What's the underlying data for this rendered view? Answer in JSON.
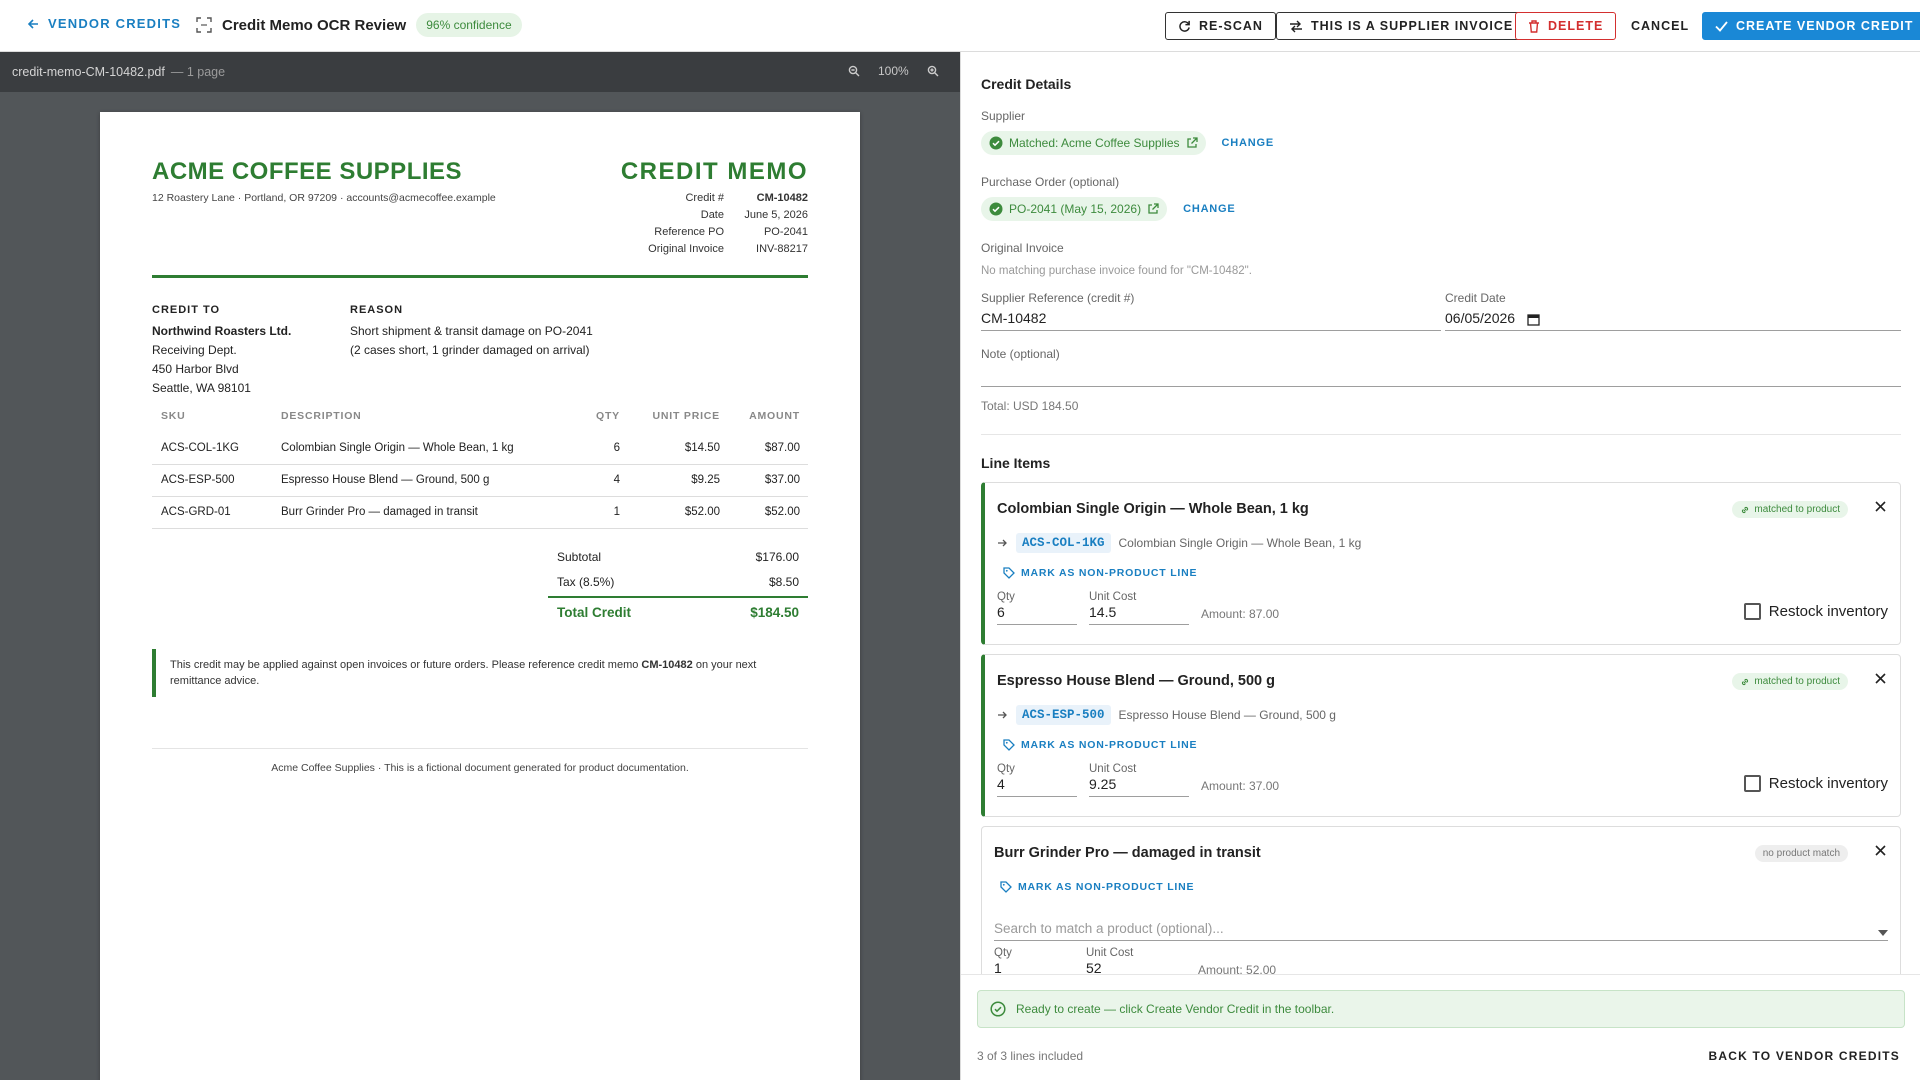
{
  "topbar": {
    "back_label": "VENDOR CREDITS",
    "title": "Credit Memo OCR Review",
    "confidence": "96% confidence",
    "rescan_label": "RE-SCAN",
    "supplier_invoice_label": "THIS IS A SUPPLIER INVOICE",
    "delete_label": "DELETE",
    "cancel_label": "CANCEL",
    "create_label": "CREATE VENDOR CREDIT"
  },
  "viewer": {
    "filename": "credit-memo-CM-10482.pdf",
    "pages": "— 1 page",
    "zoom": "100%"
  },
  "document": {
    "company": "ACME COFFEE SUPPLIES",
    "address": "12 Roastery Lane · Portland, OR 97209 · accounts@acmecoffee.example",
    "doc_title": "CREDIT MEMO",
    "meta": [
      {
        "k": "Credit #",
        "v": "CM-10482"
      },
      {
        "k": "Date",
        "v": "June 5, 2026"
      },
      {
        "k": "Reference PO",
        "v": "PO-2041"
      },
      {
        "k": "Original Invoice",
        "v": "INV-88217"
      }
    ],
    "credit_to_head": "CREDIT TO",
    "credit_to": [
      "Northwind Roasters Ltd.",
      "Receiving Dept.",
      "450 Harbor Blvd",
      "Seattle, WA 98101"
    ],
    "reason_head": "REASON",
    "reason": [
      "Short shipment & transit damage on PO-2041",
      "(2 cases short, 1 grinder damaged on arrival)"
    ],
    "table_headers": [
      "SKU",
      "DESCRIPTION",
      "QTY",
      "UNIT PRICE",
      "AMOUNT"
    ],
    "rows": [
      [
        "ACS-COL-1KG",
        "Colombian Single Origin — Whole Bean, 1 kg",
        "6",
        "$14.50",
        "$87.00"
      ],
      [
        "ACS-ESP-500",
        "Espresso House Blend — Ground, 500 g",
        "4",
        "$9.25",
        "$37.00"
      ],
      [
        "ACS-GRD-01",
        "Burr Grinder Pro — damaged in transit",
        "1",
        "$52.00",
        "$52.00"
      ]
    ],
    "subtotal_label": "Subtotal",
    "subtotal": "$176.00",
    "tax_label": "Tax (8.5%)",
    "tax": "$8.50",
    "total_label": "Total Credit",
    "total": "$184.50",
    "note_pre": "This credit may be applied against open invoices or future orders. Please reference credit memo ",
    "note_bold": "CM-10482",
    "note_post": " on your next remittance advice.",
    "footer": "Acme Coffee Supplies · This is a fictional document generated for product documentation."
  },
  "panel": {
    "details_title": "Credit Details",
    "supplier_label": "Supplier",
    "supplier_value": "Matched: Acme Coffee Supplies",
    "po_label": "Purchase Order (optional)",
    "po_value": "PO-2041 (May 15, 2026)",
    "change_label": "CHANGE",
    "orig_invoice_label": "Original Invoice",
    "orig_invoice_hint": "No matching purchase invoice found for \"CM-10482\".",
    "supplier_ref_label": "Supplier Reference (credit #)",
    "supplier_ref_value": "CM-10482",
    "credit_date_label": "Credit Date",
    "credit_date_value": "06/05/2026",
    "note_label": "Note (optional)",
    "total_text": "Total: USD 184.50",
    "line_items_title": "Line Items",
    "nonproduct_label": "MARK AS NON-PRODUCT LINE",
    "qty_label": "Qty",
    "unit_cost_label": "Unit Cost",
    "restock_label": "Restock inventory",
    "lines": [
      {
        "title": "Colombian Single Origin — Whole Bean, 1 kg",
        "badge": "matched to product",
        "sku": "ACS-COL-1KG",
        "product": "Colombian Single Origin — Whole Bean, 1 kg",
        "qty": "6",
        "unit_cost": "14.5",
        "amount": "Amount: 87.00"
      },
      {
        "title": "Espresso House Blend — Ground, 500 g",
        "badge": "matched to product",
        "sku": "ACS-ESP-500",
        "product": "Espresso House Blend — Ground, 500 g",
        "qty": "4",
        "unit_cost": "9.25",
        "amount": "Amount: 37.00"
      },
      {
        "title": "Burr Grinder Pro — damaged in transit",
        "badge": "no product match",
        "search_placeholder": "Search to match a product (optional)...",
        "qty": "1",
        "unit_cost": "52",
        "amount": "Amount: 52.00"
      }
    ],
    "status": "Ready to create — click Create Vendor Credit in the toolbar.",
    "lines_count": "3 of 3 lines included",
    "back_label": "BACK TO VENDOR CREDITS"
  },
  "colors": {
    "accent": "#1a88d6",
    "green": "#2e7d32",
    "danger": "#d32f2f"
  }
}
